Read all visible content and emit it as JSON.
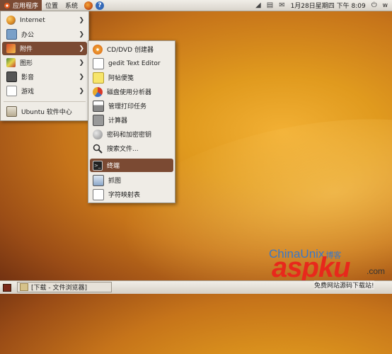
{
  "top_panel": {
    "menus": [
      "应用程序",
      "位置",
      "系统"
    ],
    "clock": "1月28日星期四 下午 8:09",
    "user": "w"
  },
  "app_menu": {
    "items": [
      {
        "label": "Internet",
        "icon": "globe-icon"
      },
      {
        "label": "办公",
        "icon": "office-icon"
      },
      {
        "label": "附件",
        "icon": "accessories-icon"
      },
      {
        "label": "图形",
        "icon": "graphics-icon"
      },
      {
        "label": "影音",
        "icon": "multimedia-icon"
      },
      {
        "label": "游戏",
        "icon": "games-icon"
      },
      {
        "label": "Ubuntu 软件中心",
        "icon": "software-center-icon"
      }
    ]
  },
  "accessories_menu": {
    "items": [
      {
        "label": "CD/DVD 创建器",
        "icon": "disc-icon"
      },
      {
        "label": "gedit Text Editor",
        "icon": "text-editor-icon"
      },
      {
        "label": "阿帖便笺",
        "icon": "sticky-note-icon"
      },
      {
        "label": "磁盘使用分析器",
        "icon": "disk-usage-icon"
      },
      {
        "label": "管理打印任务",
        "icon": "printer-icon"
      },
      {
        "label": "计算器",
        "icon": "calculator-icon"
      },
      {
        "label": "密码和加密密钥",
        "icon": "keys-icon"
      },
      {
        "label": "搜索文件...",
        "icon": "search-icon"
      },
      {
        "label": "终端",
        "icon": "terminal-icon"
      },
      {
        "label": "抓图",
        "icon": "screenshot-icon"
      },
      {
        "label": "字符映射表",
        "icon": "character-map-icon"
      }
    ]
  },
  "taskbar": {
    "window_label": "[下载 - 文件浏览器]"
  },
  "watermark": {
    "site": "ChinaUnix",
    "cn": "博客",
    "brand": "aspku",
    "tld": ".com",
    "sub": "免费网站源码下载站!"
  },
  "colors": {
    "highlight": "#7b4a33",
    "menu_bg": "#efece6",
    "watermark_red": "#e8281c",
    "watermark_blue": "#3a78c8"
  }
}
